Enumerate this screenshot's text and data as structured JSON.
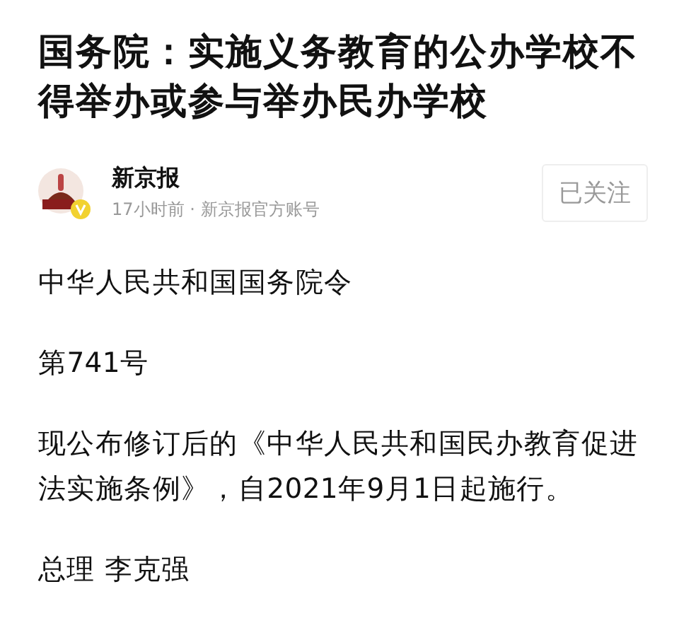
{
  "title": "国务院：实施义务教育的公办学校不得举办或参与举办民办学校",
  "author": {
    "name": "新京报",
    "time": "17小时前",
    "separator": "·",
    "source": "新京报官方账号",
    "verified": true,
    "followed": true,
    "follow_label": "已关注"
  },
  "paragraphs": [
    "中华人民共和国国务院令",
    "第741号",
    "现公布修订后的《中华人民共和国民办教育促进法实施条例》，自2021年9月1日起施行。",
    "总理 李克强"
  ]
}
